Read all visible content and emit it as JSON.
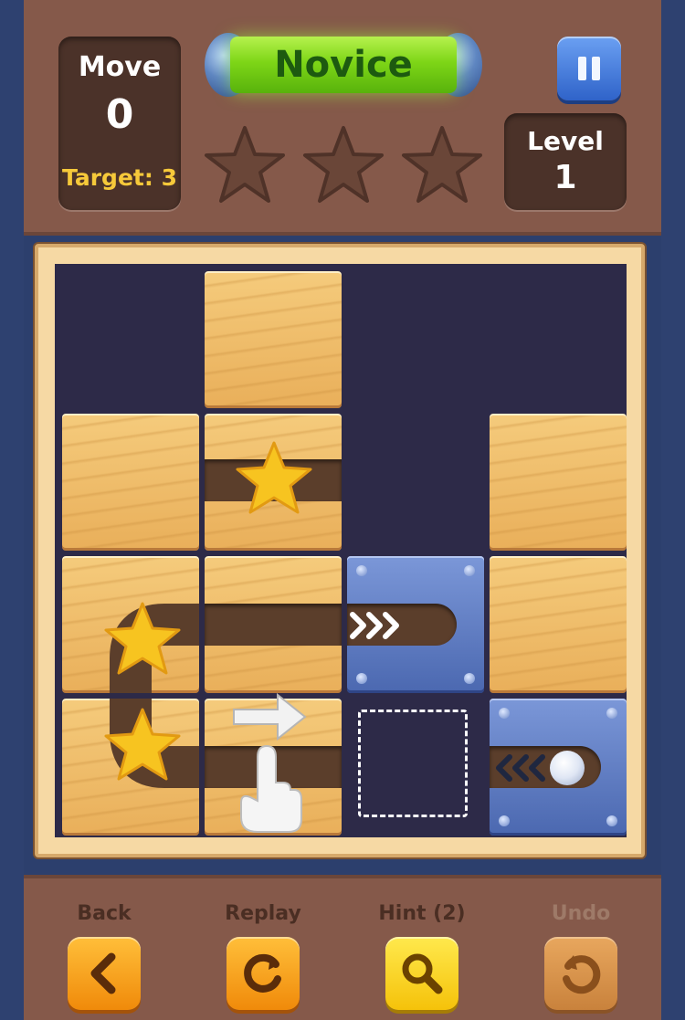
{
  "header": {
    "move_label": "Move",
    "move_value": "0",
    "target_label": "Target: 3",
    "difficulty": "Novice",
    "level_label": "Level",
    "level_value": "1",
    "stars_earned": 0,
    "stars_total": 3
  },
  "colors": {
    "header_bg": "#85594a",
    "panel_dark": "#4b3229",
    "target_text": "#f6c93a",
    "difficulty_bar": "#7ed617",
    "board_bg": "#2d2a48",
    "wood": "#f0bf6b",
    "metal": "#5b79c4",
    "page_bg": "#2c3f6d"
  },
  "icons": {
    "pause": "pause-icon",
    "back": "chevron-left-icon",
    "replay": "replay-icon",
    "hint": "magnifier-icon",
    "undo": "undo-icon"
  },
  "footer": {
    "back_label": "Back",
    "replay_label": "Replay",
    "hint_label": "Hint (2)",
    "undo_label": "Undo"
  }
}
